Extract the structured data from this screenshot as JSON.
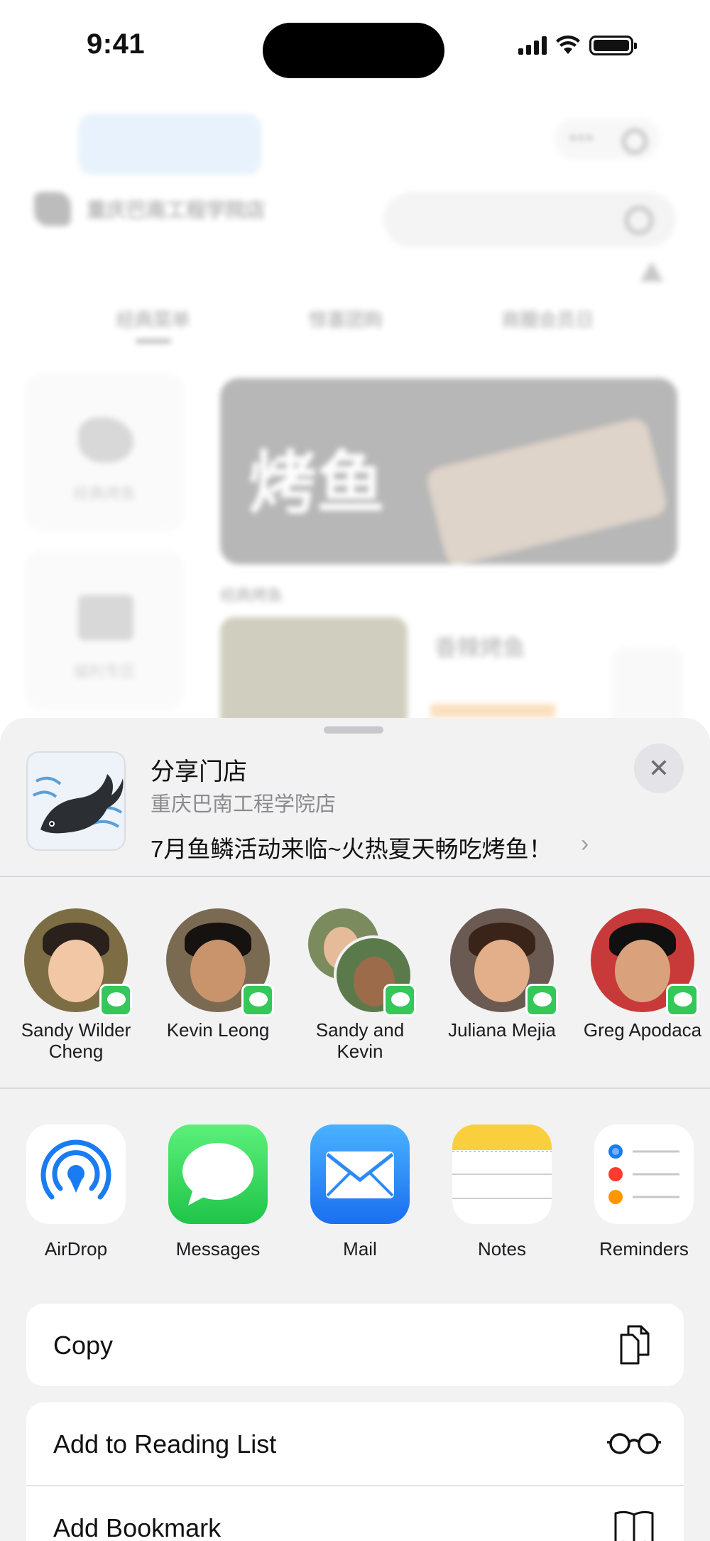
{
  "status_bar": {
    "time": "9:41"
  },
  "background_app": {
    "promo_text": "",
    "store_name": "重庆巴南工程学院店",
    "store_distance": "",
    "search_placeholder": "",
    "notice_text": "",
    "tabs": [
      "经典菜单",
      "惊喜团购",
      "商圈会员日"
    ],
    "side_categories": [
      "经典烤鱼",
      "福利专区"
    ],
    "banner_title": "烤鱼",
    "section_title": "经典烤鱼",
    "dish_name": "香辣烤鱼",
    "dish_sold": ""
  },
  "share_sheet": {
    "title": "分享门店",
    "subtitle": "重庆巴南工程学院店",
    "description": "7月鱼鳞活动来临~火热夏天畅吃烤鱼！",
    "close_icon": "close-icon",
    "people": [
      {
        "name": "Sandy Wilder Cheng",
        "line1": "Sandy Wilder",
        "line2": "Cheng",
        "app": "messages-badge-icon"
      },
      {
        "name": "Kevin Leong",
        "line1": "Kevin Leong",
        "line2": "",
        "app": "messages-badge-icon"
      },
      {
        "name": "Sandy and Kevin",
        "line1": "Sandy and",
        "line2": "Kevin",
        "app": "messages-badge-icon"
      },
      {
        "name": "Juliana Mejia",
        "line1": "Juliana Mejia",
        "line2": "",
        "app": "messages-badge-icon"
      },
      {
        "name": "Greg Apodaca",
        "line1": "Greg Apodaca",
        "line2": "",
        "app": "messages-badge-icon"
      }
    ],
    "apps": [
      {
        "label": "AirDrop",
        "icon": "airdrop-icon"
      },
      {
        "label": "Messages",
        "icon": "messages-icon"
      },
      {
        "label": "Mail",
        "icon": "mail-icon"
      },
      {
        "label": "Notes",
        "icon": "notes-icon"
      },
      {
        "label": "Reminders",
        "icon": "reminders-icon"
      }
    ],
    "actions": [
      {
        "label": "Copy",
        "icon": "copy-icon"
      },
      {
        "label": "Add to Reading List",
        "icon": "glasses-icon"
      },
      {
        "label": "Add Bookmark",
        "icon": "book-icon"
      }
    ]
  }
}
